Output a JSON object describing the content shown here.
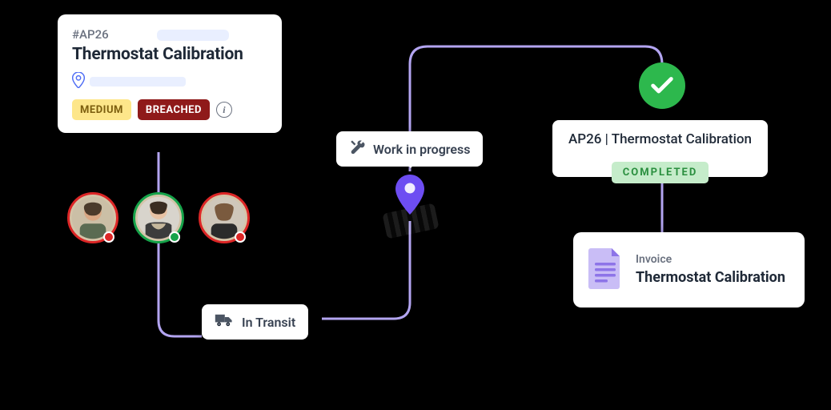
{
  "ticket": {
    "id": "#AP26",
    "title": "Thermostat Calibration",
    "priority_label": "MEDIUM",
    "sla_label": "BREACHED"
  },
  "technicians": [
    {
      "status": "unavailable",
      "ring": "red"
    },
    {
      "status": "available",
      "ring": "green"
    },
    {
      "status": "unavailable",
      "ring": "red"
    }
  ],
  "transit": {
    "label": "In Transit"
  },
  "wip": {
    "label": "Work in progress"
  },
  "completed": {
    "title": "AP26 | Thermostat Calibration",
    "badge": "COMPLETED"
  },
  "invoice": {
    "label": "Invoice",
    "title": "Thermostat Calibration"
  },
  "colors": {
    "connector": "#b3a5f1",
    "success": "#2db84d",
    "danger_ring": "#dc2626",
    "ok_ring": "#16a34a"
  }
}
